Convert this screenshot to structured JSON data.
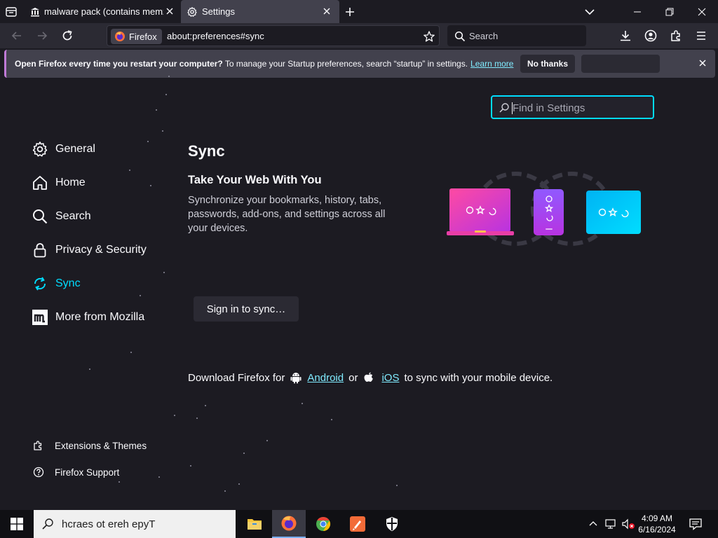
{
  "tabs": [
    {
      "title": "malware pack (contains memz)",
      "icon": "museum-icon"
    },
    {
      "title": "Settings",
      "icon": "gear-icon"
    }
  ],
  "navbar": {
    "identity_label": "Firefox",
    "url": "about:preferences#sync",
    "search_placeholder": "Search"
  },
  "notification": {
    "bold_text": "Open Firefox every time you restart your computer?",
    "text": " To manage your Startup preferences, search “startup” in settings.",
    "link": "Learn more",
    "no_thanks": "No thanks"
  },
  "settings": {
    "find_placeholder": "Find in Settings",
    "categories": [
      {
        "label": "General",
        "icon": "gear-icon"
      },
      {
        "label": "Home",
        "icon": "home-icon"
      },
      {
        "label": "Search",
        "icon": "search-icon"
      },
      {
        "label": "Privacy & Security",
        "icon": "lock-icon"
      },
      {
        "label": "Sync",
        "icon": "sync-icon",
        "selected": true
      },
      {
        "label": "More from Mozilla",
        "icon": "mozilla-icon"
      }
    ],
    "footer": [
      {
        "label": "Extensions & Themes",
        "icon": "puzzle-icon"
      },
      {
        "label": "Firefox Support",
        "icon": "help-icon"
      }
    ]
  },
  "sync": {
    "heading": "Sync",
    "subheading": "Take Your Web With You",
    "description": "Synchronize your bookmarks, history, tabs, passwords, add-ons, and settings across all your devices.",
    "signin_button": "Sign in to sync…",
    "download_prefix": "Download Firefox for",
    "android": "Android",
    "or": "or",
    "ios": "iOS",
    "download_suffix": "to sync with your mobile device."
  },
  "taskbar": {
    "search_text": "hcraes ot ereh epyT",
    "time": "4:09 AM",
    "date": "6/16/2024",
    "apps": [
      "file-explorer-icon",
      "firefox-icon",
      "chrome-icon",
      "app-icon",
      "security-icon"
    ]
  },
  "colors": {
    "accent": "#00ddff",
    "link": "#80ebff",
    "background": "#1c1b22"
  }
}
